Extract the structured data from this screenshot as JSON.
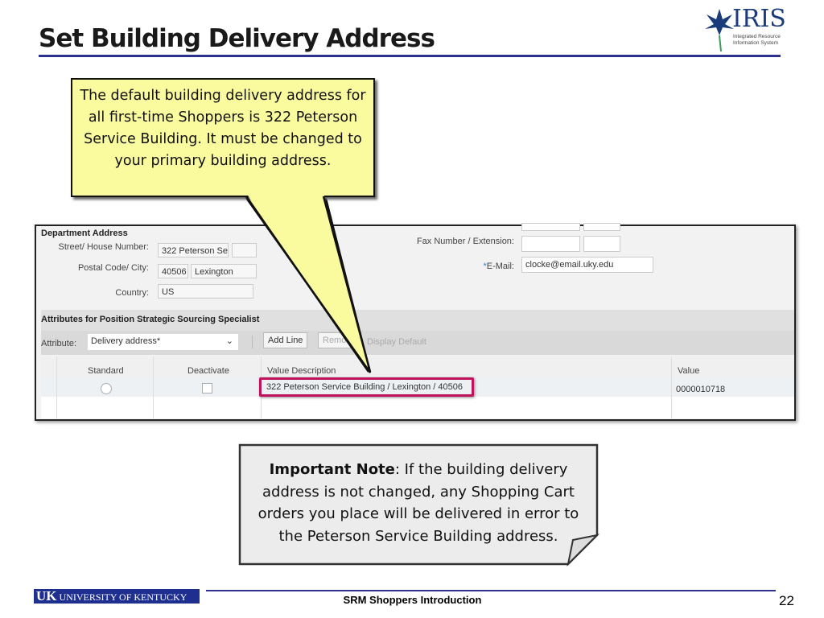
{
  "slide": {
    "title": "Set Building Delivery Address",
    "page_number": "22",
    "footer": "SRM Shoppers Introduction",
    "logo_text": "IRIS",
    "logo_subtitle": "Integrated Resource Information System",
    "university_logo_text": "UNIVERSITY OF KENTUCKY",
    "university_logo_mark": "UK"
  },
  "callout": {
    "text": "The default building delivery address for all first-time Shoppers is 322 Peterson Service Building. It must be changed to your primary building address."
  },
  "note": {
    "bold": "Important Note",
    "text": ": If the building delivery address is not changed, any Shopping Cart orders you place will be delivered in error to the Peterson Service Building address."
  },
  "sap": {
    "section_title": "Department Address",
    "street_label": "Street/ House Number:",
    "street_value": "322 Peterson Se",
    "house_number": "",
    "postal_label": "Postal Code/ City:",
    "postal_value": "40506",
    "city_value": "Lexington",
    "country_label": "Country:",
    "country_value": "US",
    "fax_label": "Fax Number / Extension:",
    "fax_value": "",
    "fax_ext": "",
    "email_label": "E-Mail:",
    "email_required": "*",
    "email_value": "clocke@email.uky.edu",
    "attributes_title": "Attributes for Position Strategic Sourcing Specialist",
    "attribute_label": "Attribute:",
    "attribute_value": "Delivery address*",
    "add_line": "Add Line",
    "remove": "Remo",
    "display_default": "Display Default",
    "columns": [
      "Standard",
      "Deactivate",
      "Value Description",
      "Value"
    ],
    "rows": [
      {
        "standard": false,
        "deactivate": false,
        "value_description": "322 Peterson Service Building / Lexington / 40506",
        "value": "0000010718"
      }
    ],
    "highlight_color": "#c0135e"
  }
}
